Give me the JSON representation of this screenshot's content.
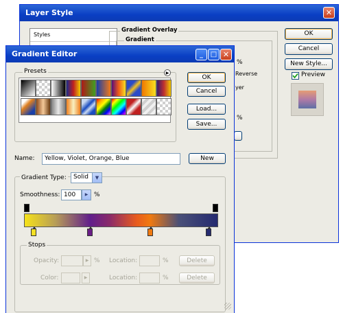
{
  "layer_style": {
    "title": "Layer Style",
    "sidebar_first_item": "Styles",
    "section_title": "Gradient Overlay",
    "sub_title": "Gradient",
    "partial_reverse": "Reverse",
    "partial_layer": "yer",
    "percent_a": "%",
    "percent_b": "%",
    "buttons": {
      "ok": "OK",
      "cancel": "Cancel",
      "new_style": "New Style..."
    },
    "preview_label": "Preview",
    "preview_checked": true,
    "preview_colors": [
      "#e59c74",
      "#b07aa6",
      "#5e6fa5"
    ]
  },
  "gradient_editor": {
    "title": "Gradient Editor",
    "presets_label": "Presets",
    "menu_arrow": "▶",
    "presets": [
      "linear-gradient(135deg,#000 0%,#fff 100%)",
      "repeating-conic-gradient(#cfcfcf 0 25%,#fff 0 50%)",
      "linear-gradient(90deg,#fff 0%,#000 100%)",
      "linear-gradient(90deg,#1a2b8a,#c02020,#f0c800)",
      "linear-gradient(90deg,#b01818,#40a020)",
      "linear-gradient(90deg,#1a3fa8,#f07818)",
      "linear-gradient(90deg,#5a0c7a,#f05c18,#f8e020)",
      "linear-gradient(135deg,#2a4bc8 30%,#f0c020 50%,#2a4bc8 70%)",
      "linear-gradient(90deg,#f07800,#f8e020)",
      "linear-gradient(90deg,#3a1a6a,#c03030,#f0c800)",
      "linear-gradient(135deg,#fff 20%,#e08020 40%,#1a3fa8 80%)",
      "linear-gradient(90deg,#8c4a1c,#f4c898,#6a3a10)",
      "linear-gradient(90deg,#808080,#e8e8e8,#808080)",
      "linear-gradient(90deg,#f08020,#f8f0c0,#f08020)",
      "linear-gradient(135deg,#c8d8f0 20%,#1a4cc0 45%,#c8d8f0 60%,#1a4cc0 80%)",
      "linear-gradient(135deg,red,orange,yellow,green,blue,violet)",
      "linear-gradient(135deg,#ff0000,#ffff00,#00ff00,#00ffff,#0000ff,#ff00ff)",
      "linear-gradient(135deg,#c02020 30%,#f8f8f8 50%,#c02020 70%)",
      "repeating-linear-gradient(135deg,#f0f0f0 0 4px,#d0d0d0 4px 8px)",
      "repeating-conic-gradient(#cfcfcf 0 25%,#fff 0 50%)"
    ],
    "name_label": "Name:",
    "name_value": "Yellow, Violet, Orange, Blue",
    "buttons": {
      "ok": "OK",
      "cancel": "Cancel",
      "load": "Load...",
      "save": "Save...",
      "new": "New",
      "delete1": "Delete",
      "delete2": "Delete"
    },
    "gradient_type_label": "Gradient Type:",
    "gradient_type_value": "Solid",
    "smoothness_label": "Smoothness:",
    "smoothness_value": "100",
    "smoothness_unit": "%",
    "gradient_css": "linear-gradient(90deg,#f6e21a 0%,#b79d57 16%,#611f8b 34%,#8a2a6a 44%,#e85b1e 58%,#f07a10 65%,#4a5078 80%,#252a70 100%)",
    "opacity_stops": [
      0,
      100
    ],
    "color_stops": [
      {
        "location": 5,
        "color": "#f4e024"
      },
      {
        "location": 34,
        "color": "#6a1e86"
      },
      {
        "location": 65,
        "color": "#ef7a12"
      },
      {
        "location": 95,
        "color": "#262b70"
      }
    ],
    "stops_label": "Stops",
    "opacity_label": "Opacity:",
    "color_label": "Color:",
    "location_label": "Location:",
    "location_label2": "Location:",
    "percent1": "%",
    "percent2": "%",
    "percent3": "%"
  }
}
